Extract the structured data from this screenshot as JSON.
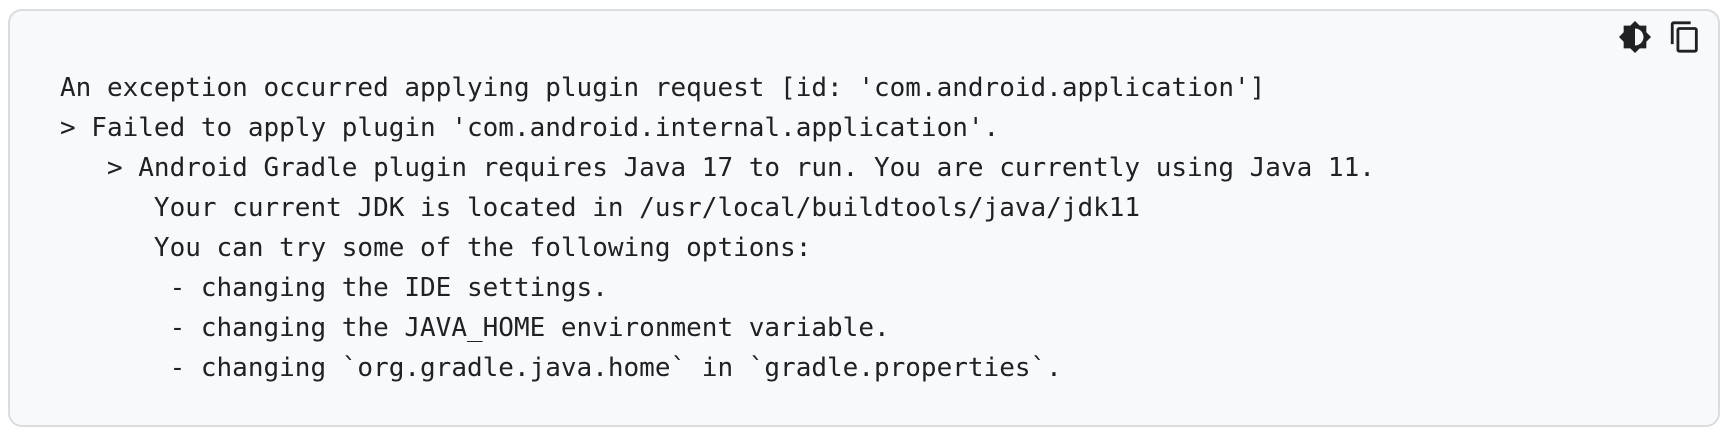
{
  "code_block": {
    "lines": [
      "An exception occurred applying plugin request [id: 'com.android.application']",
      "> Failed to apply plugin 'com.android.internal.application'.",
      "   > Android Gradle plugin requires Java 17 to run. You are currently using Java 11.",
      "      Your current JDK is located in /usr/local/buildtools/java/jdk11",
      "      You can try some of the following options:",
      "       - changing the IDE settings.",
      "       - changing the JAVA_HOME environment variable.",
      "       - changing `org.gradle.java.home` in `gradle.properties`."
    ]
  },
  "toolbar": {
    "theme_icon": "brightness-contrast-icon",
    "copy_icon": "copy-icon"
  },
  "colors": {
    "background": "#f8f9fa",
    "border": "#dadce0",
    "text": "#202124"
  }
}
